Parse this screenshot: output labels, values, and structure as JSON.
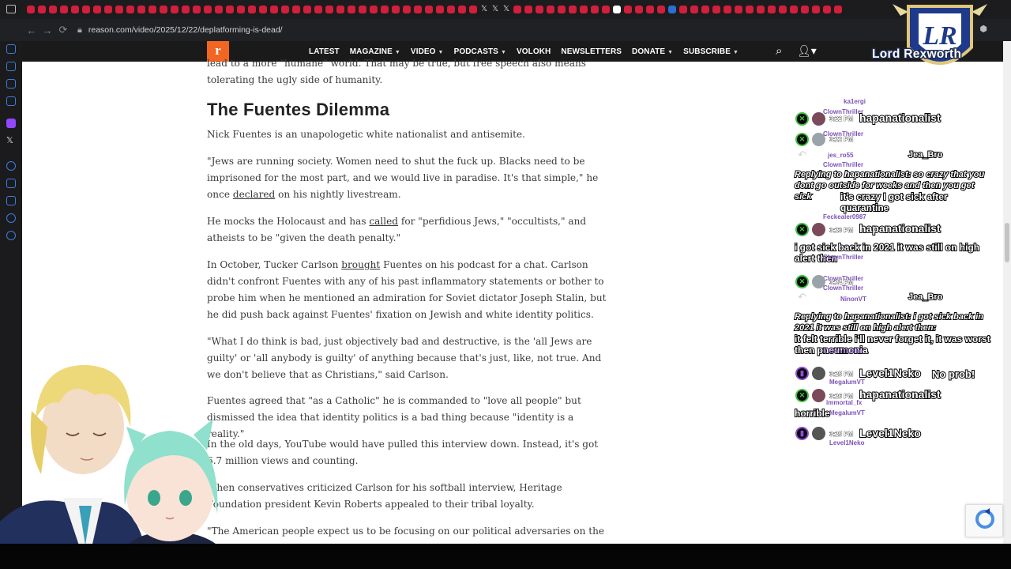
{
  "browser": {
    "url": "reason.com/video/2025/12/22/deplatforming-is-dead/"
  },
  "site": {
    "logo": "r",
    "menu": [
      {
        "label": "LATEST",
        "dropdown": false
      },
      {
        "label": "MAGAZINE",
        "dropdown": true
      },
      {
        "label": "VIDEO",
        "dropdown": true
      },
      {
        "label": "PODCASTS",
        "dropdown": true
      },
      {
        "label": "VOLOKH",
        "dropdown": false
      },
      {
        "label": "NEWSLETTERS",
        "dropdown": false
      },
      {
        "label": "DONATE",
        "dropdown": true
      },
      {
        "label": "SUBSCRIBE",
        "dropdown": true
      }
    ]
  },
  "article": {
    "intro_line1": "lead to a more \"humane\" world. That may be true, but free speech also means",
    "intro_line2": "tolerating the ugly side of humanity.",
    "heading": "The Fuentes Dilemma",
    "p1": "Nick Fuentes is an unapologetic white nationalist and antisemite.",
    "p2_before": "\"Jews are running society. Women need to shut the fuck up. Blacks need to be imprisoned for the most part, and we would live in paradise. It's that simple,\" he once ",
    "p2_link": "declared",
    "p2_after": " on his nightly livestream.",
    "p3_before": "He mocks the Holocaust and has ",
    "p3_link": "called",
    "p3_after": " for \"perfidious Jews,\" \"occultists,\" and atheists to be \"given the death penalty.\"",
    "p4_before": "In October, Tucker Carlson ",
    "p4_link": "brought",
    "p4_after": " Fuentes on his podcast for a chat. Carlson didn't confront Fuentes with any of his past inflammatory statements or bother to probe him when he mentioned an admiration for Soviet dictator Joseph Stalin, but he did push back against Fuentes' fixation on Jewish and white identity politics.",
    "p5": "\"What I do think is bad, just objectively bad and destructive, is the 'all Jews are guilty' or 'all anybody is guilty' of anything because that's just, like, not true. And we don't believe that as Christians,\" said Carlson.",
    "p6": "Fuentes agreed that \"as a Catholic\" he is commanded to \"love all people\" but dismissed the idea that identity politics is a bad thing because \"identity is a reality.\"",
    "p7": "In the old days, YouTube would have pulled this interview down. Instead, it's got 6.7 million views and counting.",
    "p8": "When conservatives criticized Carlson for his softball interview, Heritage Foundation president Kevin Roberts appealed to their tribal loyalty.",
    "p9": "\"The American people expect us to be focusing on our political adversaries on the Left,"
  },
  "chat": {
    "rows": [
      {
        "ghost": "ka1ergi",
        "user": "hapanationalist",
        "time": "3:22 PM"
      },
      {
        "ghost": "ClownThriller",
        "user": "",
        "time": "3:22 PM"
      },
      {
        "ghost": "jes_ro55",
        "user": "Jea_Bro",
        "time": ""
      },
      {
        "reply": "Replying to hapanationalist: so crazy that you dont go outside for weeks and then you get sick",
        "text": "it's crazy I got sick after quarantine"
      },
      {
        "user": "hapanationalist",
        "time": "3:23 PM",
        "text": "i got sick back in 2021 it was still on high alert then"
      },
      {
        "ghost": "ClownThriller",
        "time": "3:24 PM"
      },
      {
        "ghost": "NinonVT",
        "user": "Jea_Bro"
      },
      {
        "reply": "Replying to hapanationalist: i got sick back in 2021 it was still on high alert then:",
        "text": "it felt terrible i'll never forget it, it was worst then pneumonia"
      },
      {
        "user": "Level1Neko",
        "time": "3:25 PM",
        "text": "No prob!"
      },
      {
        "user": "hapanationalist",
        "time": "3:26 PM",
        "text": "horrible"
      },
      {
        "user": "Level1Neko",
        "time": "3:25 PM"
      }
    ],
    "ghosts": [
      "ClownThriller",
      "ClownThriller",
      "ClownThriller",
      "Feckealer0987",
      "ClownThriller",
      "ClownThriller",
      "ClownThriller",
      "ClownThriller",
      "MegalumVT",
      "immortal_fx",
      "MegalumVT",
      "Level1Neko"
    ]
  },
  "overlay": {
    "watermark": "Lord Rexworth",
    "crest_initials": "LR"
  },
  "colors": {
    "reason_orange": "#f26522",
    "nav_bg": "#1a1a1a",
    "youtube_badge": "#3fc23f",
    "twitch_badge": "#8f4fd8"
  }
}
